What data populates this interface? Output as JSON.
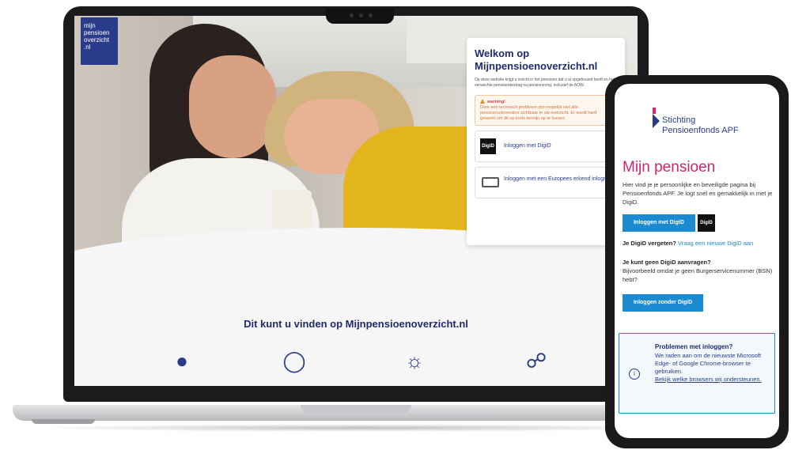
{
  "laptop": {
    "logo": [
      "mijn",
      "pensioen",
      "overzicht",
      ".nl"
    ],
    "login": {
      "title": "Welkom op Mijnpensioenoverzicht.nl",
      "intro": "Op deze website krijgt u inzicht in het pensioen dat u al opgebouwd heeft en het verwachte pensioenbedrag na pensionering, inclusief de AOW.",
      "warning_title": "warning!",
      "warning_body": "Door een technisch probleem zijn mogelijk niet alle pensioenuitvoerders zichtbaar in uw overzicht. Er wordt hard gewerkt om dit op korte termijn op te lossen.",
      "digid_badge": "DigiD",
      "digid_label": "Inloggen met DigiD",
      "eu_label": "Inloggen met een Europees erkend inlogmiddel"
    },
    "find_title": "Dit kunt u vinden op Mijnpensioenoverzicht.nl",
    "feature_icons": [
      "piggy-bank-icon",
      "apple-icon",
      "lightbulb-icon",
      "stroller-icon"
    ]
  },
  "phone": {
    "logo_line1": "Stichting",
    "logo_line2": "Pensioenfonds APF",
    "title": "Mijn pensioen",
    "intro": "Hier vind je je persoonlijke en beveiligde pagina bij Pensioenfonds APF. Je logt snel en gemakkelijk in met je DigiD.",
    "login_digid_button": "Inloggen met DigiD",
    "digid_badge": "DigiD",
    "forgot_label": "Je DigiD vergeten?",
    "forgot_link": "Vraag een nieuwe DigiD aan",
    "no_digid_title": "Je kunt geen DigiD aanvragen?",
    "no_digid_body": "Bijvoorbeeld omdat je geen Burgerservicenummer (BSN) hebt?",
    "login_without_button": "Inloggen zonder DigiD",
    "problem_title": "Problemen met inloggen?",
    "problem_body": "We raden aan om de nieuwste Microsoft Edge- of Google Chrome-browser te gebruiken.",
    "problem_link": "Bekijk welke browsers wij ondersteunen.",
    "info_icon": "i"
  }
}
